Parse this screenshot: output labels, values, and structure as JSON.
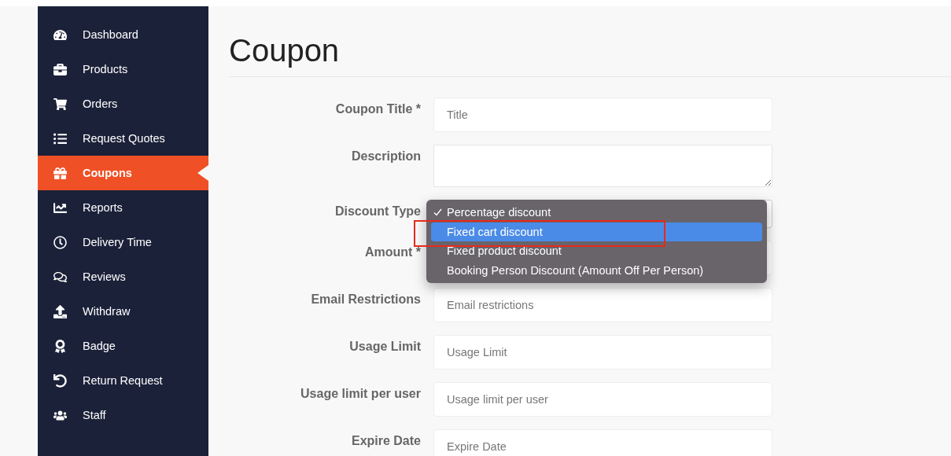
{
  "sidebar": {
    "items": [
      {
        "label": "Dashboard",
        "selected": false
      },
      {
        "label": "Products",
        "selected": false
      },
      {
        "label": "Orders",
        "selected": false
      },
      {
        "label": "Request Quotes",
        "selected": false
      },
      {
        "label": "Coupons",
        "selected": true
      },
      {
        "label": "Reports",
        "selected": false
      },
      {
        "label": "Delivery Time",
        "selected": false
      },
      {
        "label": "Reviews",
        "selected": false
      },
      {
        "label": "Withdraw",
        "selected": false
      },
      {
        "label": "Badge",
        "selected": false
      },
      {
        "label": "Return Request",
        "selected": false
      },
      {
        "label": "Staff",
        "selected": false
      }
    ]
  },
  "page": {
    "title": "Coupon"
  },
  "form": {
    "fields": [
      {
        "label": "Coupon Title *",
        "kind": "input",
        "placeholder": "Title"
      },
      {
        "label": "Description",
        "kind": "textarea"
      },
      {
        "label": "Discount Type",
        "kind": "select",
        "options": [
          {
            "label": "Percentage discount",
            "checked": true,
            "selected": false
          },
          {
            "label": "Fixed cart discount",
            "checked": false,
            "selected": true
          },
          {
            "label": "Fixed product discount",
            "checked": false,
            "selected": false
          },
          {
            "label": "Booking Person Discount (Amount Off Per Person)",
            "checked": false,
            "selected": false
          }
        ]
      },
      {
        "label": "Amount *",
        "kind": "input"
      },
      {
        "label": "Email Restrictions",
        "kind": "input",
        "placeholder": "Email restrictions"
      },
      {
        "label": "Usage Limit",
        "kind": "input",
        "placeholder": "Usage Limit"
      },
      {
        "label": "Usage limit per user",
        "kind": "input",
        "placeholder": "Usage limit per user"
      },
      {
        "label": "Expire Date",
        "kind": "input",
        "placeholder": "Expire Date"
      }
    ]
  }
}
